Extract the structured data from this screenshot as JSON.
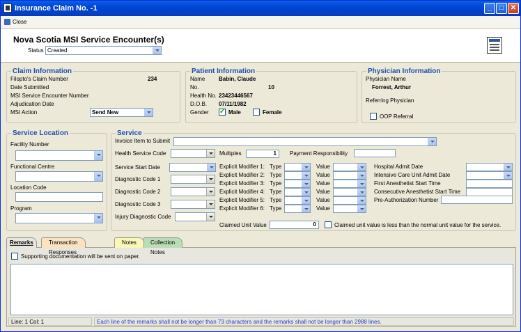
{
  "window": {
    "title": "Insurance Claim No. -1"
  },
  "toolbar": {
    "close_label": "Close"
  },
  "header": {
    "title": "Nova Scotia MSI Service Encounter(s)",
    "status_label": "Status",
    "status_value": "Created"
  },
  "claim": {
    "title": "Claim Information",
    "claim_number_label": "Filopto's Claim Number",
    "claim_number": "234",
    "date_submitted_label": "Date Submitted",
    "encounter_number_label": "MSI Service Encounter Number",
    "adjudication_label": "Adjudication Date",
    "action_label": "MSI Action",
    "action_value": "Send New"
  },
  "patient": {
    "title": "Patient Information",
    "name_label": "Name",
    "name": "Babin, Claude",
    "no_label": "No.",
    "no": "10",
    "health_label": "Health No.",
    "health": "23423446567",
    "dob_label": "D.O.B.",
    "dob": "07/11/1982",
    "gender_label": "Gender",
    "male_label": "Male",
    "female_label": "Female"
  },
  "physician": {
    "title": "Physician Information",
    "name_label": "Physician Name",
    "name": "Forrest, Arthur",
    "referring_label": "Referring Physician",
    "oop_label": "OOP Referral"
  },
  "location": {
    "title": "Service Location",
    "facility_label": "Facility Number",
    "functional_label": "Functional Centre",
    "location_code_label": "Location Code",
    "program_label": "Program"
  },
  "service": {
    "title": "Service",
    "invoice_label": "Invoice Item to Submit",
    "hsc_label": "Health Service Code",
    "multiples_label": "Multiples",
    "multiples": "1",
    "payment_label": "Payment Responsibility",
    "start_date_label": "Service Start Date",
    "diag1_label": "Diagnostic Code 1",
    "diag2_label": "Diagnostic Code 2",
    "diag3_label": "Diagnostic Code 3",
    "injury_label": "Injury Diagnostic Code",
    "modifiers": [
      {
        "label": "Explicit Modifier 1:",
        "type": "Type",
        "value": "Value"
      },
      {
        "label": "Explicit Modifier 2:",
        "type": "Type",
        "value": "Value"
      },
      {
        "label": "Explicit Modifier 3:",
        "type": "Type",
        "value": "Value"
      },
      {
        "label": "Explicit Modifier 4:",
        "type": "Type",
        "value": "Value"
      },
      {
        "label": "Explicit Modifier 5:",
        "type": "Type",
        "value": "Value"
      },
      {
        "label": "Explicit Modifier 6:",
        "type": "Type",
        "value": "Value"
      }
    ],
    "hospital_admit_label": "Hospital Admit Date",
    "icu_admit_label": "Intensive Care Unit Admit Date",
    "first_anesthetist_label": "First Anesthetist Start Time",
    "consec_anesthetist_label": "Consecutive Anesthetist Start Time",
    "preauth_label": "Pre-Authorization Number",
    "claimed_label": "Claimed Unit Value",
    "claimed_value": "0",
    "claimed_less_label": "Claimed unit value is less than the normal unit value for the service."
  },
  "tabs": [
    {
      "label": "Remarks",
      "color": "#E8E7DF"
    },
    {
      "label": "Transaction Responses",
      "color": "#FBE3C0"
    },
    {
      "label": "Notes",
      "color": "#FBF7B6"
    },
    {
      "label": "Collection Notes",
      "color": "#B9DDB4"
    }
  ],
  "remarks": {
    "supporting_label": "Supporting documentation will be sent on paper.",
    "line_col": "Line: 1  Col: 1",
    "hint": "Each line of the remarks shall not be longer than 73 characters and the remarks shall not be longer than 2988 lines.",
    "hint_color": "#1E3FCC"
  }
}
